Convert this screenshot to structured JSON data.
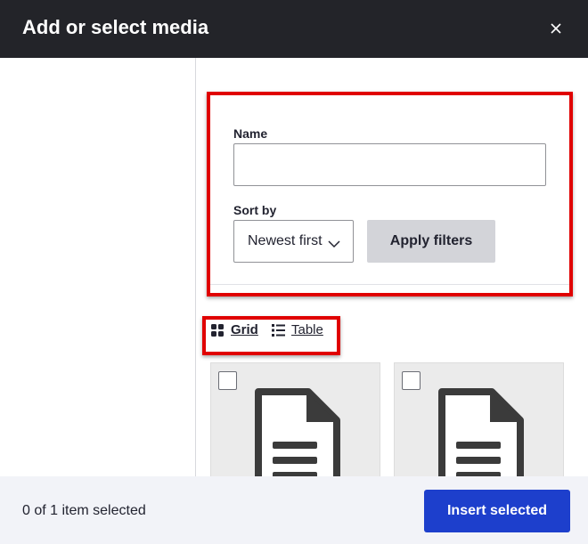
{
  "header": {
    "title": "Add or select media",
    "close_icon": "close-icon"
  },
  "filters": {
    "name_label": "Name",
    "name_value": "",
    "name_placeholder": "",
    "sort_label": "Sort by",
    "sort_selected": "Newest first",
    "apply_label": "Apply filters"
  },
  "views": {
    "grid_label": "Grid",
    "table_label": "Table",
    "active": "Grid"
  },
  "media": {
    "items": [
      {
        "icon": "document-icon",
        "checked": false
      },
      {
        "icon": "document-icon",
        "checked": false
      }
    ]
  },
  "footer": {
    "selection_text": "0 of 1 item selected",
    "insert_label": "Insert selected"
  },
  "colors": {
    "header_bg": "#232429",
    "primary_button": "#1d3fcc",
    "highlight": "#e00000",
    "footer_bg": "#f2f3f8"
  }
}
